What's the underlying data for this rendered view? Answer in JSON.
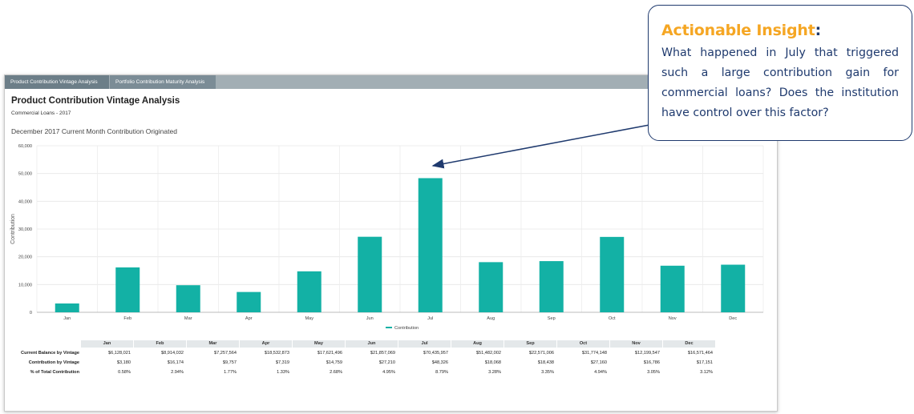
{
  "tabs": [
    {
      "label": "Product Contribution Vintage Analysis",
      "active": true
    },
    {
      "label": "Portfolio Contribution Maturity Analysis",
      "active": false
    }
  ],
  "page": {
    "title": "Product Contribution Vintage Analysis",
    "subtitle": "Commercial Loans - 2017"
  },
  "chart_data": {
    "type": "bar",
    "title": "December 2017 Current Month Contribution Originated",
    "xlabel": "",
    "ylabel": "Contribution",
    "ylim": [
      0,
      60000
    ],
    "yticks": [
      "0",
      "10,000",
      "20,000",
      "30,000",
      "40,000",
      "50,000",
      "60,000"
    ],
    "categories": [
      "Jan",
      "Feb",
      "Mar",
      "Apr",
      "May",
      "Jun",
      "Jul",
      "Aug",
      "Sep",
      "Oct",
      "Nov",
      "Dec"
    ],
    "series": [
      {
        "name": "Contribution",
        "values": [
          3180,
          16174,
          9757,
          7319,
          14759,
          27210,
          48326,
          18068,
          18438,
          27160,
          16786,
          17151
        ],
        "color": "#13b1a5"
      }
    ],
    "grid": true,
    "legend": "bottom"
  },
  "table": {
    "headers": [
      "Jan",
      "Feb",
      "Mar",
      "Apr",
      "May",
      "Jun",
      "Jul",
      "Aug",
      "Sep",
      "Oct",
      "Nov",
      "Dec"
    ],
    "rows": [
      {
        "label": "Current Balance by Vintage",
        "values": [
          "$6,128,021",
          "$8,914,032",
          "$7,257,564",
          "$18,532,873",
          "$17,621,496",
          "$21,857,069",
          "$70,435,957",
          "$51,482,002",
          "$22,571,006",
          "$31,774,148",
          "$12,199,547",
          "$16,571,464"
        ]
      },
      {
        "label": "Contribution by Vintage",
        "values": [
          "$3,180",
          "$16,174",
          "$9,757",
          "$7,319",
          "$14,759",
          "$27,210",
          "$48,326",
          "$18,068",
          "$18,438",
          "$27,160",
          "$16,786",
          "$17,151"
        ]
      },
      {
        "label": "% of Total Contribution",
        "values": [
          "0.58%",
          "2.94%",
          "1.77%",
          "1.33%",
          "2.68%",
          "4.95%",
          "8.79%",
          "3.28%",
          "3.35%",
          "4.94%",
          "3.05%",
          "3.12%"
        ]
      }
    ]
  },
  "insight": {
    "title": "Actionable Insight",
    "colon": ":",
    "text": "What happened in July that triggered such a large contribution gain for commercial loans? Does the institution have control over this factor?"
  },
  "colors": {
    "accent_orange": "#f5a623",
    "navy": "#1f3a6e",
    "bar": "#13b1a5",
    "tabbar": "#a2aeb4"
  }
}
